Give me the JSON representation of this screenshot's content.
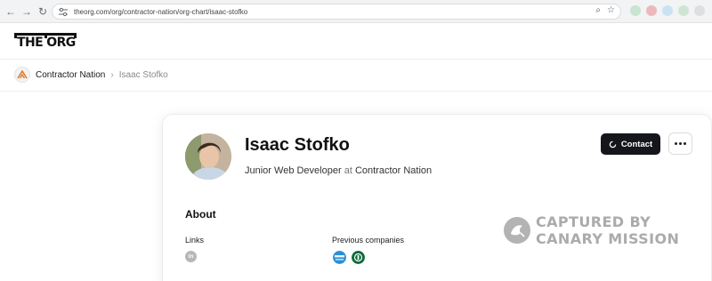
{
  "browser": {
    "url": "theorg.com/org/contractor-nation/org-chart/isaac-stofko",
    "icons": [
      "back-icon",
      "forward-icon",
      "reload-icon",
      "site-settings-icon",
      "zoom-icon",
      "bookmark-star-icon"
    ]
  },
  "site": {
    "logo_text": "THE ORG"
  },
  "breadcrumb": {
    "company": "Contractor Nation",
    "separator": "›",
    "current": "Isaac Stofko"
  },
  "profile": {
    "name": "Isaac Stofko",
    "role": "Junior Web Developer",
    "at_word": "at",
    "company": "Contractor Nation",
    "contact_label": "Contact"
  },
  "about": {
    "heading": "About",
    "links_label": "Links",
    "previous_companies_label": "Previous companies",
    "link_icons": [
      "linkedin-icon"
    ],
    "previous_company_logos": [
      "jobcorps-logo",
      "starbucks-logo"
    ]
  },
  "watermark": {
    "line1": "CAPTURED BY",
    "line2": "CANARY MISSION"
  },
  "colors": {
    "accent_button": "#15161c",
    "contractor_logo": "#e07a2e",
    "starbucks_green": "#0b6b3a",
    "jobcorps_blue": "#2d8fd6",
    "watermark_gray": "#ababab"
  }
}
